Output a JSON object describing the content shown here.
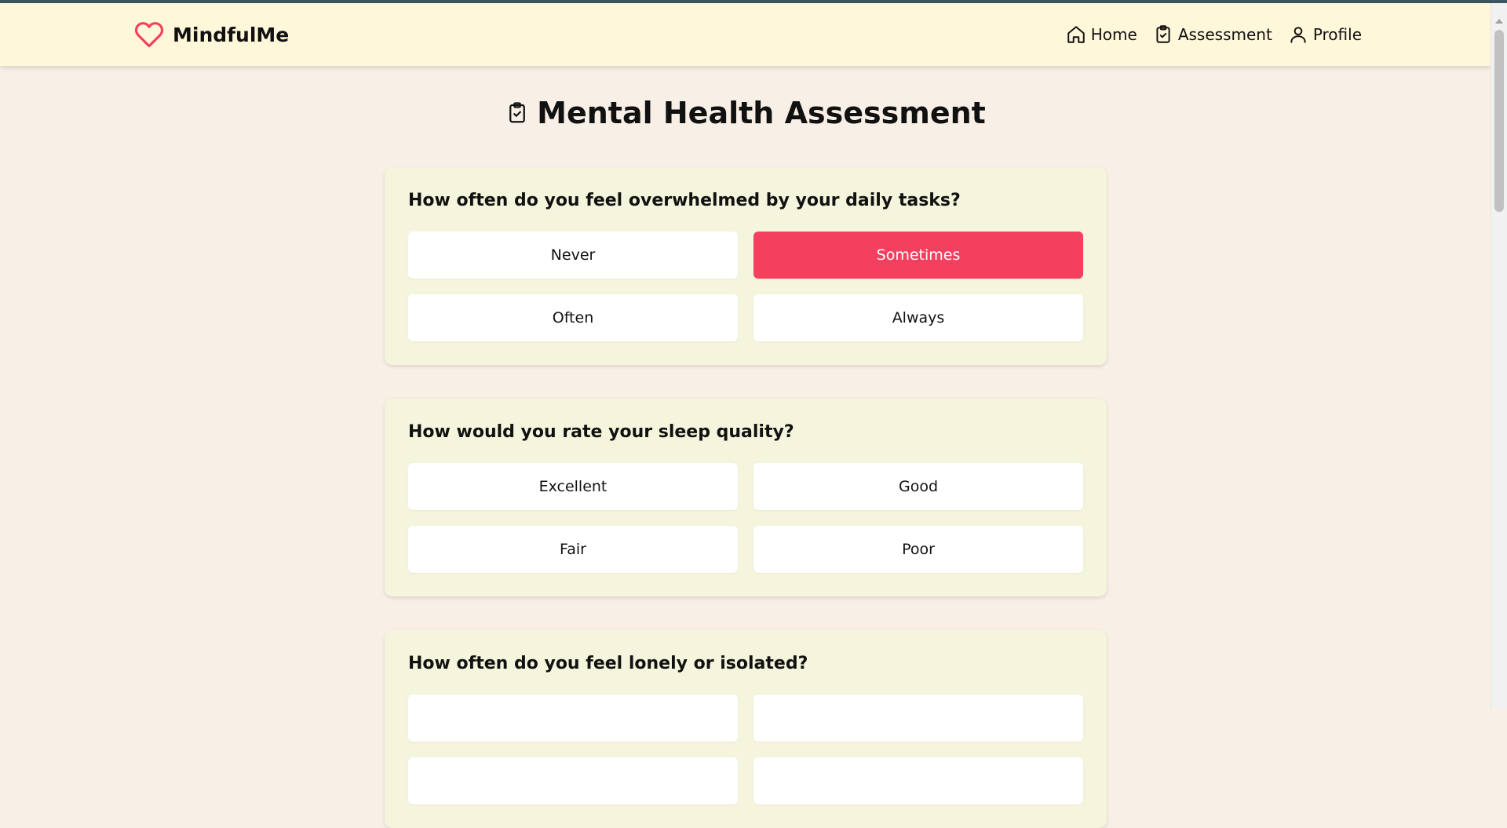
{
  "app": {
    "name": "MindfulMe",
    "logo_icon": "heart-icon",
    "accent": "#f43f5e"
  },
  "nav": [
    {
      "label": "Home",
      "icon": "home-icon"
    },
    {
      "label": "Assessment",
      "icon": "clipboard-check-icon"
    },
    {
      "label": "Profile",
      "icon": "user-icon"
    }
  ],
  "page": {
    "title": "Mental Health Assessment",
    "title_icon": "clipboard-check-icon"
  },
  "questions": [
    {
      "text": "How often do you feel overwhelmed by your daily tasks?",
      "options": [
        "Never",
        "Sometimes",
        "Often",
        "Always"
      ],
      "selected": "Sometimes"
    },
    {
      "text": "How would you rate your sleep quality?",
      "options": [
        "Excellent",
        "Good",
        "Fair",
        "Poor"
      ],
      "selected": null
    },
    {
      "text": "How often do you feel lonely or isolated?",
      "options": [
        "",
        "",
        "",
        ""
      ],
      "selected": null
    }
  ]
}
